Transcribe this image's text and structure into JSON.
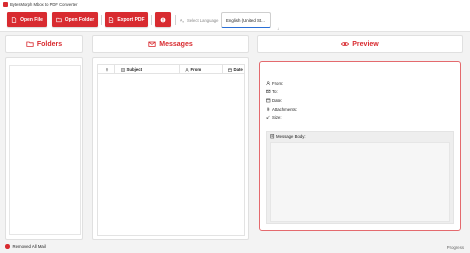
{
  "window": {
    "title": "BytesMorph Mbox to PDF Converter"
  },
  "toolbar": {
    "open_file": "Open File",
    "open_folder": "Open Folder",
    "export_pdf": "Export PDF",
    "language_label": "Select Language",
    "language_value": "English (United St..."
  },
  "panels": {
    "folders_title": "Folders",
    "messages_title": "Messages",
    "preview_title": "Preview"
  },
  "messages": {
    "columns": {
      "subject": "Subject",
      "from": "From",
      "date": "Date"
    }
  },
  "preview": {
    "from_label": "From:",
    "to_label": "To:",
    "date_label": "Date:",
    "attachments_label": "Attachments:",
    "size_label": "Size:",
    "body_label": "Message Body:"
  },
  "status": {
    "message": "Removed All Mail",
    "progress_label": "Progress"
  },
  "colors": {
    "accent": "#d82b30",
    "preview_border": "#e46a6e",
    "select_underline": "#2a6fd6"
  },
  "icons": [
    "app-icon",
    "file-icon",
    "folder-open-icon",
    "export-pdf-icon",
    "help-icon",
    "language-icon",
    "chevron-down-icon",
    "folder-icon",
    "envelope-icon",
    "eye-icon",
    "paperclip-icon",
    "document-icon",
    "user-icon",
    "email-icon",
    "calendar-icon",
    "size-icon",
    "error-icon"
  ]
}
